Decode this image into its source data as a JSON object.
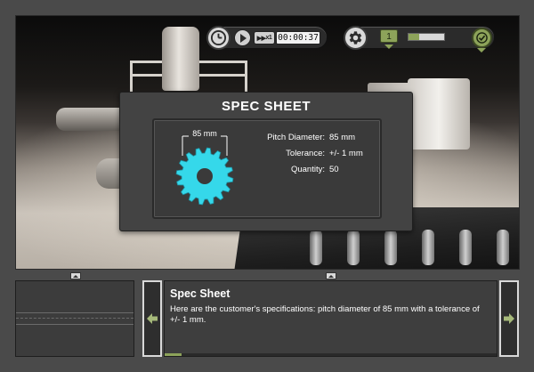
{
  "hud": {
    "timer": "00:00:37",
    "speed_label": "x1",
    "step_number": "1",
    "progress_fraction": 0.3,
    "accent": "#8da35a"
  },
  "spec_sheet": {
    "title": "SPEC SHEET",
    "dimension_label": "85 mm",
    "gear_color": "#35d8ea",
    "rows": [
      {
        "key": "Pitch Diameter:",
        "value": "85 mm"
      },
      {
        "key": "Tolerance:",
        "value": "+/- 1 mm"
      },
      {
        "key": "Quantity:",
        "value": "50"
      }
    ]
  },
  "narration": {
    "title": "Spec Sheet",
    "text": "Here are the customer's specifications: pitch diameter of 85 mm with a tolerance of +/- 1 mm.",
    "progress_fraction": 0.05
  },
  "icons": {
    "clock": "clock-icon",
    "play": "play-icon",
    "settings": "gear-icon",
    "complete": "checkmark-icon",
    "prev": "arrow-left-icon",
    "next": "arrow-right-icon"
  }
}
